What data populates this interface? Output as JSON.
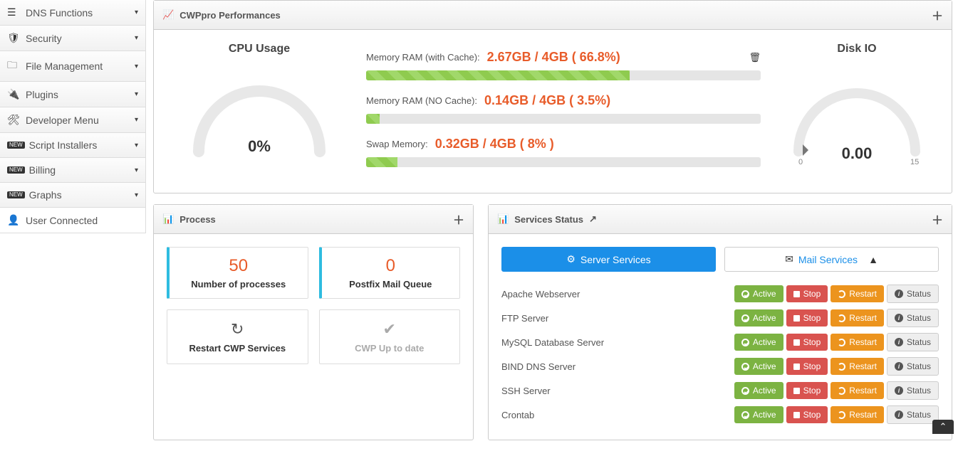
{
  "sidebar": {
    "items": [
      {
        "icon": "☰",
        "label": "DNS Functions",
        "caret": true
      },
      {
        "icon": "🛡",
        "label": "Security",
        "caret": true
      },
      {
        "icon": "🗀",
        "label": "File Management",
        "caret": true
      },
      {
        "icon": "🔌",
        "label": "Plugins",
        "caret": true
      },
      {
        "icon": "🛠",
        "label": "Developer Menu",
        "caret": true
      },
      {
        "icon": "NEW",
        "label": "Script Installers",
        "caret": true,
        "new": true
      },
      {
        "icon": "NEW",
        "label": "Billing",
        "caret": true,
        "new": true
      },
      {
        "icon": "NEW",
        "label": "Graphs",
        "caret": true,
        "new": true
      },
      {
        "icon": "👤",
        "label": "User Connected",
        "caret": false,
        "plain": true
      }
    ]
  },
  "perf": {
    "title": "CWPpro Performances",
    "cpu_title": "CPU Usage",
    "cpu_value": "0%",
    "disk_title": "Disk IO",
    "disk_value": "0.00",
    "disk_min": "0",
    "disk_max": "15",
    "mem": [
      {
        "label": "Memory RAM (with Cache):",
        "value": "2.67GB / 4GB ( 66.8%)",
        "pct": 66.8,
        "trash": true
      },
      {
        "label": "Memory RAM (NO Cache):",
        "value": "0.14GB / 4GB ( 3.5%)",
        "pct": 3.5
      },
      {
        "label": "Swap Memory:",
        "value": "0.32GB / 4GB ( 8% )",
        "pct": 8
      }
    ]
  },
  "process": {
    "title": "Process",
    "stats": [
      {
        "num": "50",
        "label": "Number of processes"
      },
      {
        "num": "0",
        "label": "Postfix Mail Queue"
      }
    ],
    "actions": [
      {
        "icon": "↻",
        "label": "Restart CWP Services",
        "enabled": true
      },
      {
        "icon": "✔",
        "label": "CWP Up to date",
        "enabled": false
      }
    ]
  },
  "services": {
    "title": "Services Status",
    "tabs": [
      {
        "icon": "⚙",
        "label": "Server Services",
        "active": true
      },
      {
        "icon": "✉",
        "label": "Mail Services",
        "active": false,
        "warn": true
      }
    ],
    "btn_active": "Active",
    "btn_stop": "Stop",
    "btn_restart": "Restart",
    "btn_status": "Status",
    "list": [
      {
        "name": "Apache Webserver"
      },
      {
        "name": "FTP Server"
      },
      {
        "name": "MySQL Database Server"
      },
      {
        "name": "BIND DNS Server"
      },
      {
        "name": "SSH Server"
      },
      {
        "name": "Crontab"
      }
    ]
  }
}
